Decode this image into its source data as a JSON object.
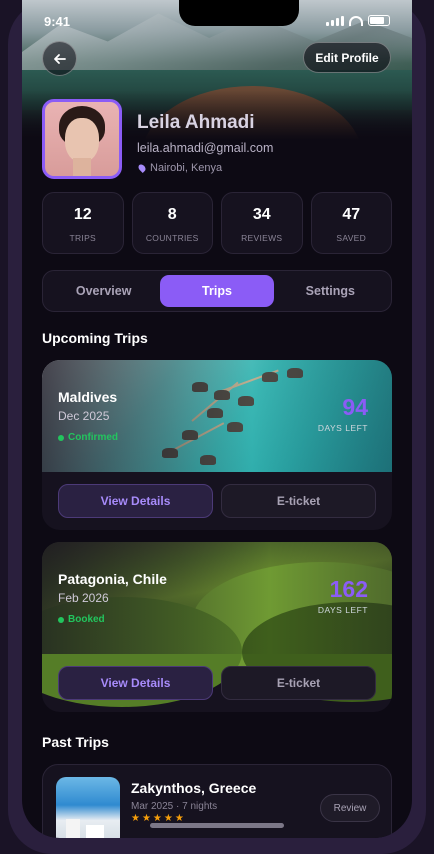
{
  "status_bar": {
    "time": "9:41"
  },
  "header": {
    "edit_label": "Edit Profile"
  },
  "profile": {
    "name": "Leila Ahmadi",
    "email": "leila.ahmadi@gmail.com",
    "location": "Nairobi, Kenya"
  },
  "stats": [
    {
      "value": "12",
      "label": "TRIPS"
    },
    {
      "value": "8",
      "label": "COUNTRIES"
    },
    {
      "value": "34",
      "label": "REVIEWS"
    },
    {
      "value": "47",
      "label": "SAVED"
    }
  ],
  "tabs": [
    {
      "label": "Overview",
      "active": false
    },
    {
      "label": "Trips",
      "active": true
    },
    {
      "label": "Settings",
      "active": false
    }
  ],
  "upcoming": {
    "title": "Upcoming Trips",
    "trips": [
      {
        "destination": "Maldives",
        "date": "Dec 2025",
        "status": "Confirmed",
        "days": "94",
        "days_label": "DAYS LEFT",
        "details_label": "View Details",
        "ticket_label": "E-ticket"
      },
      {
        "destination": "Patagonia, Chile",
        "date": "Feb 2026",
        "status": "Booked",
        "days": "162",
        "days_label": "DAYS LEFT",
        "details_label": "View Details",
        "ticket_label": "E-ticket"
      }
    ]
  },
  "past": {
    "title": "Past Trips",
    "trips": [
      {
        "destination": "Zakynthos, Greece",
        "meta": "Mar 2025 · 7 nights",
        "stars": "★★★★★",
        "review_label": "Review"
      }
    ]
  },
  "colors": {
    "accent": "#8b5cf6",
    "success": "#22c55e",
    "star": "#f59e0b",
    "background": "#0d0a14"
  }
}
